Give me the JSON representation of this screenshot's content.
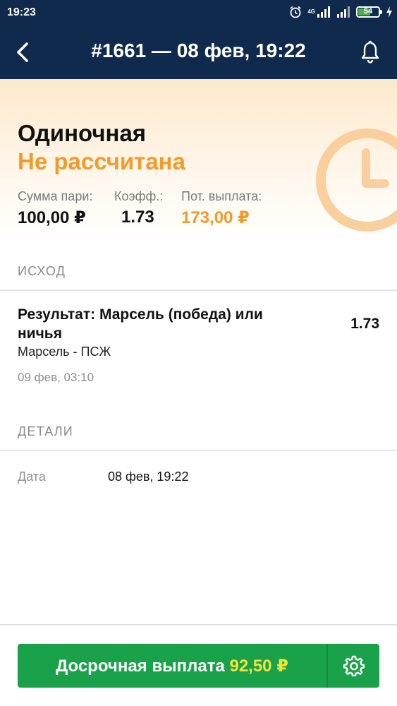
{
  "status_bar": {
    "time": "19:23",
    "network_label": "4G",
    "battery_level": "54",
    "icons": [
      "alarm-icon",
      "signal-icon",
      "signal-icon",
      "battery-icon",
      "charging-icon"
    ]
  },
  "app_bar": {
    "title": "#1661 — 08 фев, 19:22",
    "icons": [
      "back-arrow-icon",
      "bell-icon"
    ]
  },
  "summary": {
    "bet_type": "Одиночная",
    "status": "Не рассчитана",
    "status_icon": "clock-icon",
    "metrics": [
      {
        "label": "Сумма пари:",
        "value": "100,00 ₽"
      },
      {
        "label": "Коэфф.:",
        "value": "1.73"
      },
      {
        "label": "Пот. выплата:",
        "value": "173,00 ₽"
      }
    ]
  },
  "outcome_section": {
    "header": "ИСХОД",
    "title": "Результат: Марсель (победа) или ничья",
    "odds": "1.73",
    "event": "Марсель - ПСЖ",
    "date": "09 фев, 03:10"
  },
  "details_section": {
    "header": "ДЕТАЛИ",
    "rows": [
      {
        "label": "Дата",
        "value": "08 фев, 19:22"
      }
    ]
  },
  "cashout": {
    "label": "Досрочная выплата",
    "amount": "92,50 ₽",
    "settings_icon": "gear-icon"
  },
  "colors": {
    "app_bar": "#0f2a4d",
    "accent_orange": "#f39a2a",
    "cashout_green": "#1aa24a",
    "cashout_amount": "#f1e43a"
  }
}
